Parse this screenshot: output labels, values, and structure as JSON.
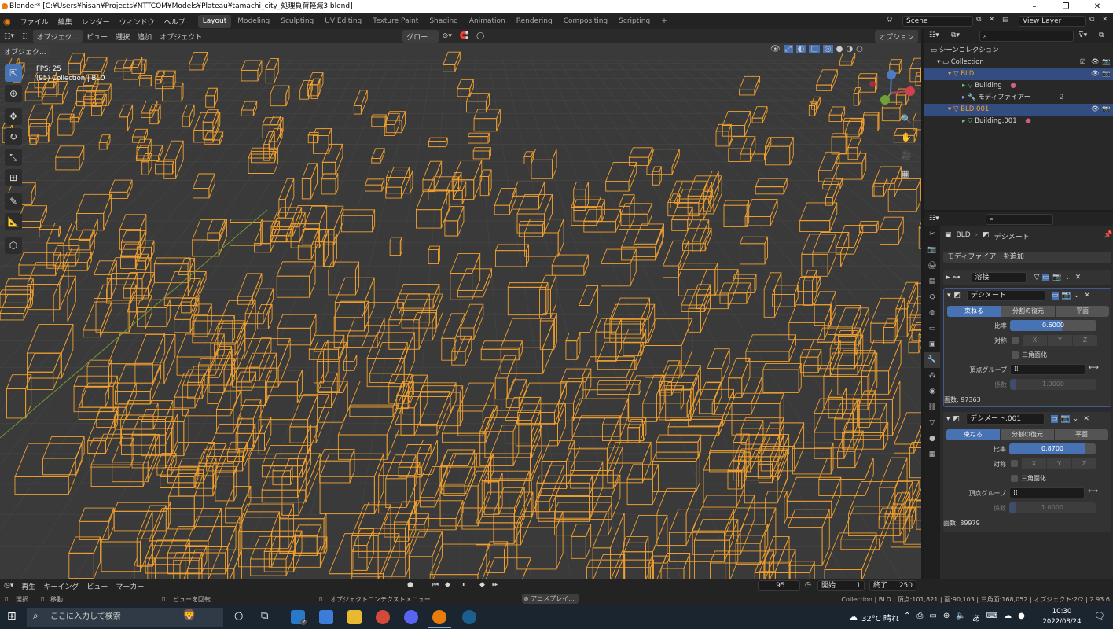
{
  "titlebar": {
    "title": "Blender* [C:¥Users¥hisah¥Projects¥NTTCOM¥Models¥Plateau¥tamachi_city_処理負荷軽減3.blend]"
  },
  "menu": [
    "ファイル",
    "編集",
    "レンダー",
    "ウィンドウ",
    "ヘルプ"
  ],
  "workspaces": [
    "Layout",
    "Modeling",
    "Sculpting",
    "UV Editing",
    "Texture Paint",
    "Shading",
    "Animation",
    "Rendering",
    "Compositing",
    "Scripting"
  ],
  "scene": {
    "name": "Scene",
    "view_layer": "View Layer"
  },
  "viewport": {
    "mode": "オブジェク...",
    "menus": [
      "ビュー",
      "選択",
      "追加",
      "オブジェクト"
    ],
    "transform_orientation": "グロー...",
    "options": "オプション",
    "fps": "FPS: 25",
    "collection_info": "(95) Collection | BLD"
  },
  "outliner": {
    "root": "シーンコレクション",
    "collection": "Collection",
    "items": [
      {
        "name": "BLD",
        "selected": true
      },
      {
        "name": "Building",
        "selected": false
      },
      {
        "name": "モディファイアー",
        "selected": false
      },
      {
        "name": "BLD.001",
        "selected": true
      },
      {
        "name": "Building.001",
        "selected": false
      }
    ],
    "modifier_count": "2"
  },
  "properties": {
    "object": "BLD",
    "context": "デシメート",
    "add_modifier": "モディファイアーを追加",
    "modifiers": [
      {
        "name": "溶接",
        "collapsed": true
      },
      {
        "name": "デシメート",
        "modes": [
          "束ねる",
          "分割の復元",
          "平面"
        ],
        "ratio_label": "比率",
        "ratio": 0.6,
        "ratio_text": "0.6000",
        "symmetry_label": "対称",
        "axes": [
          "X",
          "Y",
          "Z"
        ],
        "triangulate": "三角面化",
        "vgroup_label": "頂点グループ",
        "factor_label": "係数",
        "factor": "1.0000",
        "face_count": "面数: 97363"
      },
      {
        "name": "デシメート.001",
        "modes": [
          "束ねる",
          "分割の復元",
          "平面"
        ],
        "ratio_label": "比率",
        "ratio": 0.87,
        "ratio_text": "0.8700",
        "symmetry_label": "対称",
        "axes": [
          "X",
          "Y",
          "Z"
        ],
        "triangulate": "三角面化",
        "vgroup_label": "頂点グループ",
        "factor_label": "係数",
        "factor": "1.0000",
        "face_count": "面数: 89979"
      }
    ]
  },
  "timeline": {
    "playback": "再生",
    "keying": "キーイング",
    "view": "ビュー",
    "marker": "マーカー",
    "current_frame": "95",
    "start_label": "開始",
    "start": "1",
    "end_label": "終了",
    "end": "250"
  },
  "status": {
    "select": "選択",
    "move": "移動",
    "rotate_view": "ビューを回転",
    "context_menu": "オブジェクトコンテクストメニュー",
    "anim": "アニメプレイ...",
    "stats": "Collection | BLD | 頂点:101,821 | 面:90,103 | 三角面:168,052 | オブジェクト:2/2 | 2.93.6"
  },
  "taskbar": {
    "search_placeholder": "ここに入力して検索",
    "weather": "32°C 晴れ",
    "time": "10:30",
    "date": "2022/08/24",
    "mail_badge": "2"
  },
  "colors": {
    "accent": "#4772b3",
    "wire": "#f0a030",
    "select_row": "#334d80"
  }
}
